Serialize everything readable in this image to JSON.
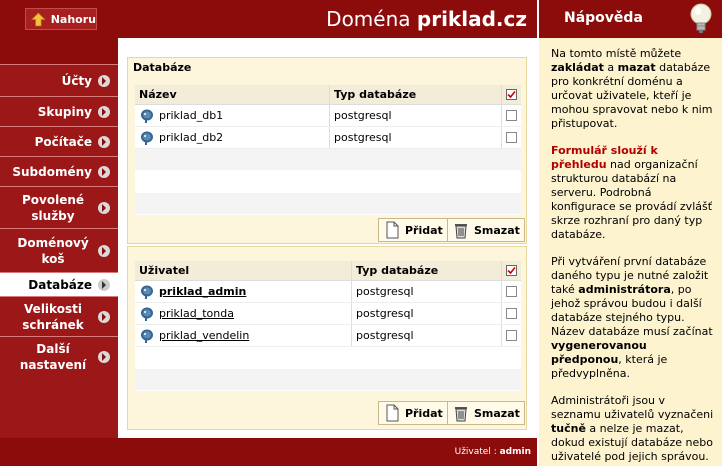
{
  "header": {
    "up_label": "Nahoru",
    "domain_prefix": "Doména",
    "domain_name": "priklad.cz"
  },
  "sidebar": {
    "items": [
      {
        "label": "Účty"
      },
      {
        "label": "Skupiny"
      },
      {
        "label": "Počítače"
      },
      {
        "label": "Subdomény"
      },
      {
        "label": "Povolené služby"
      },
      {
        "label": "Doménový koš"
      },
      {
        "label": "Databáze",
        "active": true
      },
      {
        "label": "Velikosti schránek"
      },
      {
        "label": "Další nastavení"
      }
    ]
  },
  "databases": {
    "title": "Databáze",
    "col_name": "Název",
    "col_type": "Typ databáze",
    "rows": [
      {
        "name": "priklad_db1",
        "type": "postgresql"
      },
      {
        "name": "priklad_db2",
        "type": "postgresql"
      }
    ],
    "add_label": "Přidat",
    "delete_label": "Smazat"
  },
  "users": {
    "col_user": "Uživatel",
    "col_type": "Typ databáze",
    "rows": [
      {
        "name": "priklad_admin",
        "type": "postgresql"
      },
      {
        "name": "priklad_tonda",
        "type": "postgresql"
      },
      {
        "name": "priklad_vendelin",
        "type": "postgresql"
      }
    ],
    "add_label": "Přidat",
    "delete_label": "Smazat"
  },
  "help": {
    "title": "Nápověda",
    "p1_a": "Na tomto místě můžete ",
    "p1_b": "zakládat",
    "p1_c": " a ",
    "p1_d": "mazat",
    "p1_e": " databáze pro konkrétní doménu a určovat uživatele, kteří je mohou spravovat nebo k nim přistupovat.",
    "p2_a": "Formulář slouží k přehledu",
    "p2_b": " nad organizační strukturou databází na serveru. Podrobná konfigurace se provádí zvlášť skrze rozhraní pro daný typ databáze.",
    "p3_a": "Při vytváření první databáze daného typu je nutné založit také ",
    "p3_b": "administrátora",
    "p3_c": ", po jehož správou budou i další databáze stejného typu. Název databáze musí začínat ",
    "p3_d": "vygenerovanou předponou",
    "p3_e": ", která je předvyplněna.",
    "p4_a": "Administrátoři jsou v seznamu uživatelů vyznačeni ",
    "p4_b": "tučně",
    "p4_c": " a nelze je mazat, dokud existují databáze nebo uživatelé pod jejich správou."
  },
  "footer": {
    "user_label": "Uživatel : ",
    "user_name": "admin"
  },
  "colors": {
    "brand": "#8c0c0c",
    "sidebar": "#9c1818",
    "panel": "#fdf6dc",
    "help_bg": "#fdf3cf",
    "accent_red": "#b00000"
  }
}
